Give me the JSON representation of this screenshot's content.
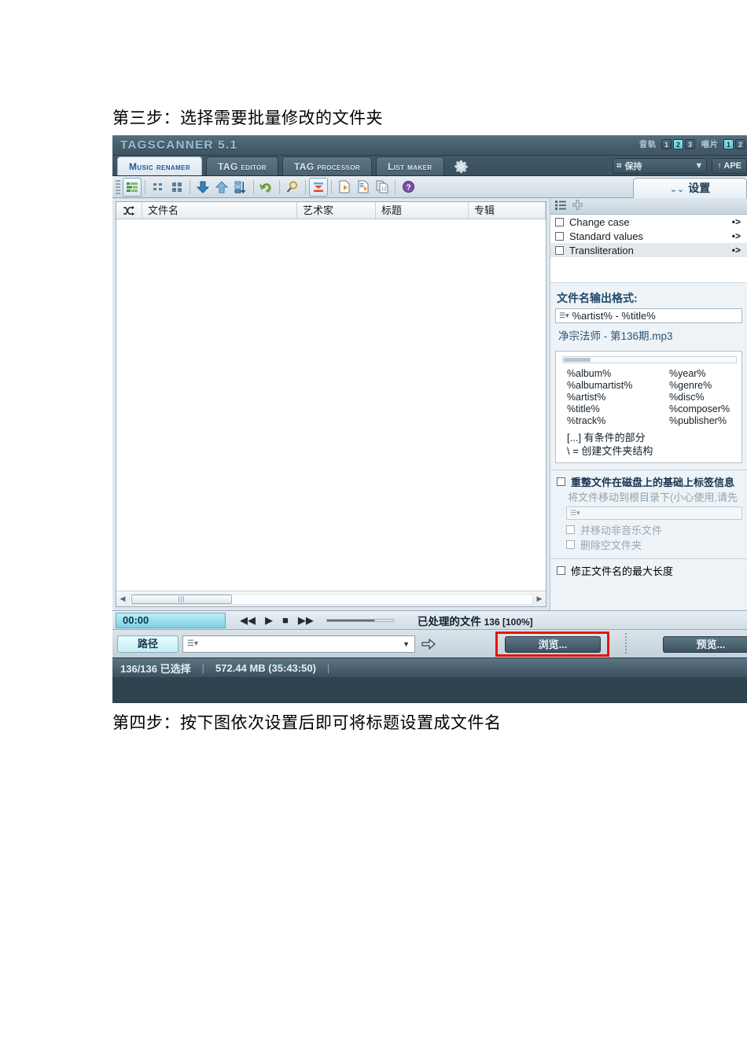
{
  "document": {
    "caption_top": "第三步：选择需要批量修改的文件夹",
    "caption_bottom": "第四步：按下图依次设置后即可将标题设置成文件名"
  },
  "titlebar": {
    "app_name": "TAGSCANNER 5.1",
    "track_label": "音轨",
    "track_badges": [
      "1",
      "2",
      "3"
    ],
    "track_active_index": 1,
    "disc_label": "唱片",
    "disc_badges": [
      "1",
      "2"
    ],
    "disc_active_index": 0
  },
  "tabs": [
    {
      "label": "Music renamer",
      "active": true
    },
    {
      "label": "TAG editor",
      "active": false
    },
    {
      "label": "TAG processor",
      "active": false
    },
    {
      "label": "List maker",
      "active": false
    }
  ],
  "tabstrip_right": {
    "gear_icon": "gear-icon",
    "select_combo_label": "保持",
    "select_combo_icon": "selection-icon",
    "ape_button_label": "↑ APE"
  },
  "toolbar": {
    "icons": [
      "list-view-icon",
      "small-icons-icon",
      "large-icons-icon",
      "move-down-icon",
      "move-up-icon",
      "sort-icon",
      "undo-icon",
      "search-icon",
      "filter-icon",
      "file-play-icon",
      "file-export-icon",
      "file-copy-icon",
      "help-icon"
    ]
  },
  "settings_tab": {
    "label": "设置",
    "icon": "settings-icon"
  },
  "filelist": {
    "columns": [
      "",
      "文件名",
      "艺术家",
      "标题",
      "专辑"
    ],
    "mark_column_icon": "shuffle-icon",
    "rows": [],
    "hscroll_left_arrow": "◀",
    "hscroll_right_arrow": "▶",
    "hscroll_thumb_glyph": "|||"
  },
  "settings_panel": {
    "toolbar_icons": [
      "list-icon",
      "plus-icon"
    ],
    "actions": [
      {
        "label": "Change case",
        "checked": false,
        "selected": false,
        "arrow": "•>"
      },
      {
        "label": "Standard values",
        "checked": false,
        "selected": false,
        "arrow": "•>"
      },
      {
        "label": "Transliteration",
        "checked": false,
        "selected": true,
        "arrow": "•>"
      }
    ],
    "format_label": "文件名输出格式:",
    "format_value": "%artist% - %title%",
    "format_dropdown_icon": "list-dropdown-icon",
    "preview_text": "净宗法师 - 第136期.mp3",
    "tags_left": [
      "%album%",
      "%albumartist%",
      "%artist%",
      "%title%",
      "%track%"
    ],
    "tags_right": [
      "%year%",
      "%genre%",
      "%disc%",
      "%composer%",
      "%publisher%"
    ],
    "note_conditional": "[...] 有条件的部分",
    "note_folder": "\\ = 创建文件夹结构",
    "reorg_label": "重整文件在磁盘上的基础上标签信息",
    "reorg_checked": false,
    "move_hint": "将文件移动到根目录下(小心使用,请先",
    "move_input_icon": "list-dropdown-icon",
    "move_nonmusic_label": "并移动非音乐文件",
    "move_nonmusic_checked": false,
    "delete_empty_label": "删除空文件夹",
    "delete_empty_checked": false,
    "maxlen_label": "修正文件名的最大长度",
    "maxlen_checked": false
  },
  "player": {
    "time": "00:00",
    "controls": [
      "prev-icon",
      "play-icon",
      "stop-icon",
      "next-icon"
    ],
    "volume_percent": 72,
    "processed_label": "已处理的文件",
    "processed_value": "136 [100%]"
  },
  "pathbar": {
    "path_button_label": "路径",
    "path_value": "",
    "path_dropdown_icon": "list-dropdown-icon",
    "path_caret_icon": "chevron-down-icon",
    "go_icon": "arrow-right-icon",
    "browse_button_label": "浏览...",
    "preview_button_label": "预览...",
    "highlight_color": "#e8140f"
  },
  "statusbar": {
    "selection": "136/136 已选择",
    "size": "572.44 MB (35:43:50)",
    "separator": "|"
  }
}
